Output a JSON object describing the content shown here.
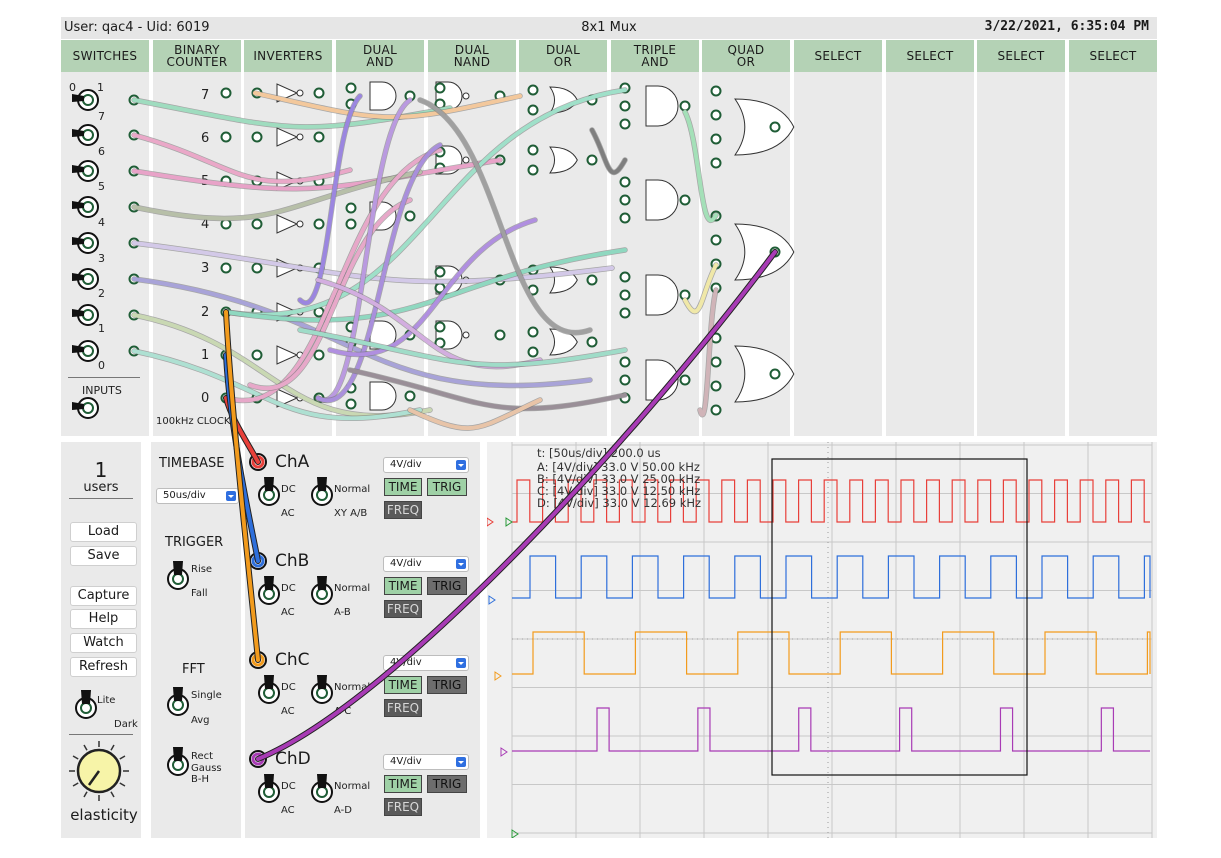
{
  "topbar": {
    "user": "User: qac4 - Uid: 6019",
    "title": "8x1 Mux",
    "datetime": "3/22/2021, 6:35:04 PM"
  },
  "headers": [
    {
      "l1": "SWITCHES",
      "l2": ""
    },
    {
      "l1": "BINARY",
      "l2": "COUNTER"
    },
    {
      "l1": "INVERTERS",
      "l2": ""
    },
    {
      "l1": "DUAL",
      "l2": "AND"
    },
    {
      "l1": "DUAL",
      "l2": "NAND"
    },
    {
      "l1": "DUAL",
      "l2": "OR"
    },
    {
      "l1": "TRIPLE",
      "l2": "AND"
    },
    {
      "l1": "QUAD",
      "l2": "OR"
    },
    {
      "l1": "SELECT",
      "l2": ""
    },
    {
      "l1": "SELECT",
      "l2": ""
    },
    {
      "l1": "SELECT",
      "l2": ""
    },
    {
      "l1": "SELECT",
      "l2": ""
    }
  ],
  "switch_numbers": [
    "7",
    "6",
    "5",
    "4",
    "3",
    "2",
    "1",
    "0"
  ],
  "switch_zero_one": [
    "0",
    "1"
  ],
  "inputs_label": "INPUTS",
  "counter_bits": [
    "7",
    "6",
    "5",
    "4",
    "3",
    "2",
    "1",
    "0"
  ],
  "clock_label": "100kHz CLOCK",
  "users": {
    "count": "1",
    "label": "users"
  },
  "buttons": [
    "Load",
    "Save",
    "Capture",
    "Help",
    "Watch",
    "Refresh"
  ],
  "theme": {
    "on": "Lite",
    "off": "Dark"
  },
  "knob_label": "elasticity",
  "timebase": {
    "title": "TIMEBASE",
    "value": "50us/div"
  },
  "trigger": {
    "title": "TRIGGER",
    "on": "Rise",
    "off": "Fall"
  },
  "fft": {
    "title": "FFT",
    "on": "Single",
    "off": "Avg",
    "window_on": "Rect",
    "window_mid": "Gauss",
    "window_off": "B-H"
  },
  "channels": [
    {
      "name": "ChA",
      "color": "#e8403a",
      "scale": "4V/div",
      "coupling_on": "DC",
      "coupling_off": "AC",
      "mode_on": "Normal",
      "mode_off": "XY A/B"
    },
    {
      "name": "ChB",
      "color": "#2e6fdb",
      "scale": "4V/div",
      "coupling_on": "DC",
      "coupling_off": "AC",
      "mode_on": "Normal",
      "mode_off": "A-B"
    },
    {
      "name": "ChC",
      "color": "#f29b1d",
      "scale": "4V/div",
      "coupling_on": "DC",
      "coupling_off": "AC",
      "mode_on": "Normal",
      "mode_off": "A-C"
    },
    {
      "name": "ChD",
      "color": "#a83bb5",
      "scale": "4V/div",
      "coupling_on": "DC",
      "coupling_off": "AC",
      "mode_on": "Normal",
      "mode_off": "A-D"
    }
  ],
  "channel_buttons": {
    "time": "TIME",
    "trig": "TRIG",
    "freq": "FREQ"
  },
  "scope_readout": [
    "t: [50us/div] 200.0 us",
    "A: [4V/div] 33.0 V  50.00 kHz",
    "B: [4V/div] 33.0 V  25.00 kHz",
    "C: [4V/div] 33.0 V  12.50 kHz",
    "D: [4V/div] 33.0 V  12.69 kHz"
  ],
  "waveforms": [
    {
      "channel": "A",
      "color": "#e8403a",
      "frequency_khz": 50.0
    },
    {
      "channel": "B",
      "color": "#2e6fdb",
      "frequency_khz": 25.0
    },
    {
      "channel": "C",
      "color": "#f29b1d",
      "frequency_khz": 12.5
    },
    {
      "channel": "D",
      "color": "#a83bb5",
      "frequency_khz": 12.69
    }
  ]
}
